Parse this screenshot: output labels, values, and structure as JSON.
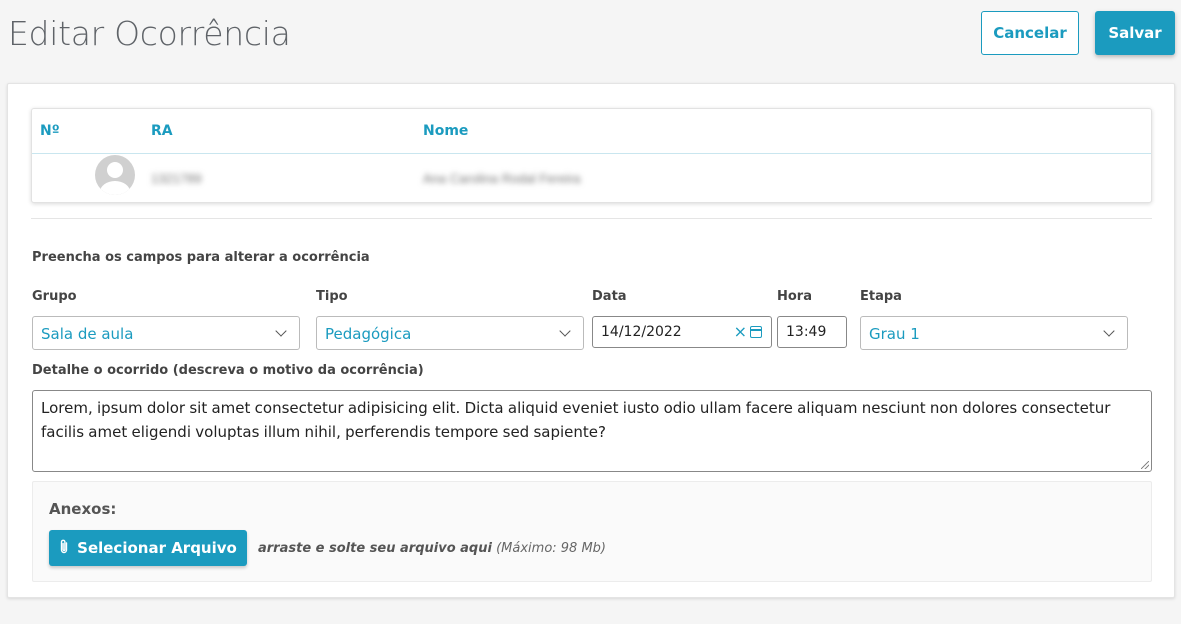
{
  "header": {
    "title": "Editar Ocorrência",
    "cancel_label": "Cancelar",
    "save_label": "Salvar"
  },
  "table": {
    "columns": [
      "Nº",
      "RA",
      "Nome"
    ],
    "rows": [
      {
        "num": "",
        "ra": "1321789",
        "nome": "Ana Carolina Rodal Fereira"
      }
    ]
  },
  "form": {
    "instructions": "Preencha os campos para alterar a ocorrência",
    "grupo": {
      "label": "Grupo",
      "value": "Sala de aula"
    },
    "tipo": {
      "label": "Tipo",
      "value": "Pedagógica"
    },
    "data": {
      "label": "Data",
      "value": "14/12/2022"
    },
    "hora": {
      "label": "Hora",
      "value": "13:49"
    },
    "etapa": {
      "label": "Etapa",
      "value": "Grau 1"
    },
    "detalhe": {
      "label": "Detalhe o ocorrido (descreva o motivo da ocorrência)",
      "value": "Lorem, ipsum dolor sit amet consectetur adipisicing elit. Dicta aliquid eveniet iusto odio ullam facere aliquam nesciunt non dolores consectetur facilis amet eligendi voluptas illum nihil, perferendis tempore sed sapiente?"
    }
  },
  "anexos": {
    "title": "Anexos:",
    "button_label": "Selecionar Arquivo",
    "drop_hint": "arraste e solte seu arquivo aqui",
    "max_size": "(Máximo: 98 Mb)"
  },
  "colors": {
    "accent": "#1b9bbf"
  },
  "icons": [
    "chevron-down-icon",
    "clear-icon",
    "calendar-icon",
    "paperclip-icon",
    "avatar-placeholder-icon"
  ]
}
